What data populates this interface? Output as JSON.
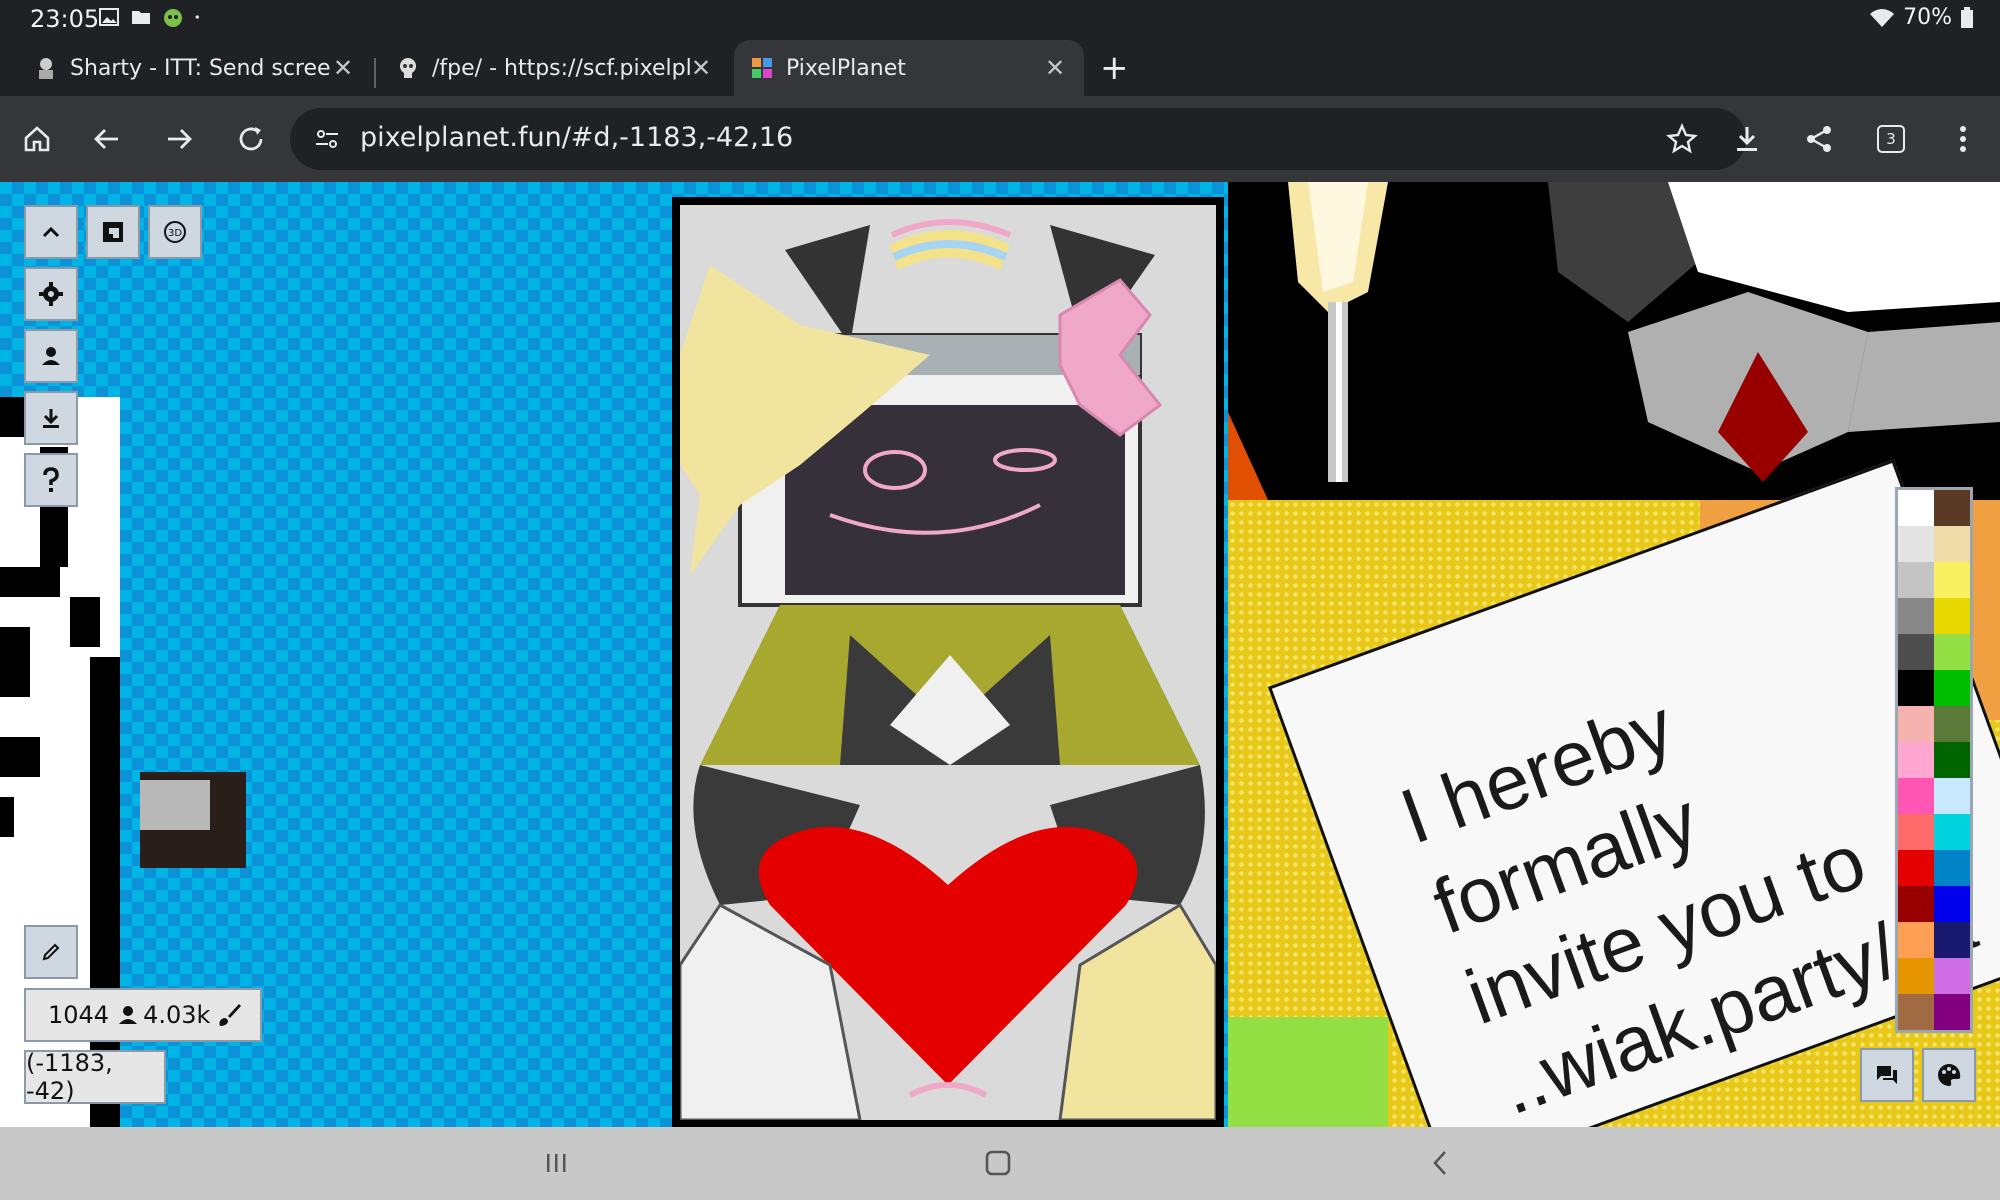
{
  "status_bar": {
    "time": "23:05",
    "battery": "70%",
    "icons": [
      "image-icon",
      "folder-icon",
      "android-head-icon",
      "dot-icon"
    ]
  },
  "tabs": [
    {
      "title": "Sharty - ITT: Send screen",
      "favicon": "sharty-favicon",
      "active": false
    },
    {
      "title": "/fpe/ - https://scf.pixelpla",
      "favicon": "skull-favicon",
      "active": false
    },
    {
      "title": "PixelPlanet",
      "favicon": "pixelplanet-favicon",
      "active": true
    }
  ],
  "toolbar": {
    "url": "pixelplanet.fun/#d,-1183,-42,16",
    "tab_count": "3"
  },
  "canvas": {
    "online_count": "1044",
    "pixel_count": "4.03k",
    "coordinates": "(-1183, -42)",
    "invite_text": "I hereby\nformally\ninvite you to\n..wiak.party/ca"
  },
  "palette": {
    "colors": [
      "#ffffff",
      "#5b3a25",
      "#e4e4e4",
      "#f0dca8",
      "#c4c4c4",
      "#f8f060",
      "#888888",
      "#e8d800",
      "#4e4e4e",
      "#94e044",
      "#000000",
      "#00be00",
      "#f4b3ae",
      "#5b7a3a",
      "#ffa7d1",
      "#006400",
      "#ff55b3",
      "#c8e8ff",
      "#ff6a6a",
      "#00d3dd",
      "#e50000",
      "#0083c7",
      "#980000",
      "#0000ea",
      "#ff9e55",
      "#191970",
      "#e59500",
      "#cf6ee4",
      "#a06a42",
      "#820080"
    ]
  },
  "colors": {
    "ui_button_bg": "#cfd8e0",
    "chrome_bg": "#202124",
    "toolbar_bg": "#35363a"
  }
}
